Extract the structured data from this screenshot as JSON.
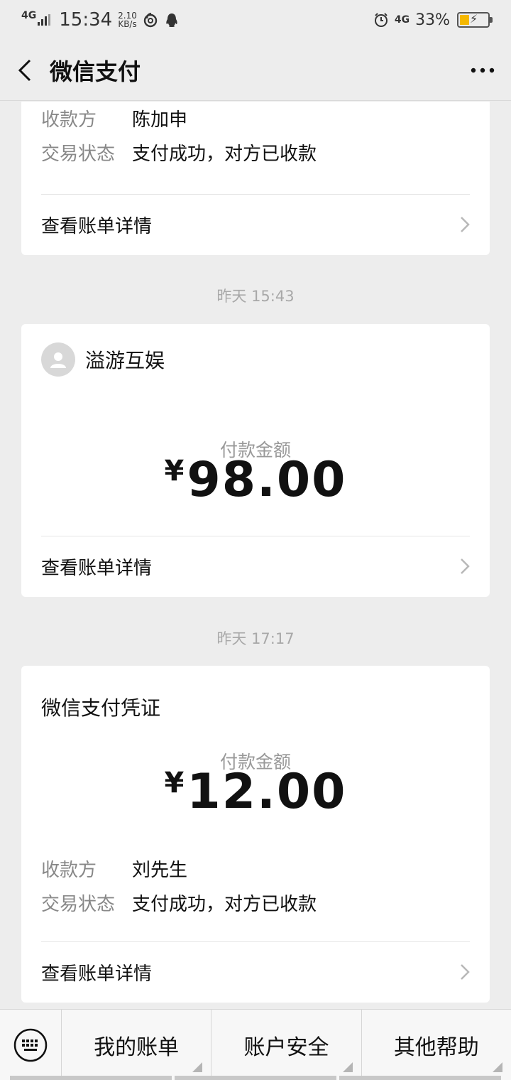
{
  "status_bar": {
    "network": "4G",
    "time": "15:34",
    "net_speed_value": "2.10",
    "net_speed_unit": "KB/s",
    "network_right": "4G",
    "battery_percent": "33%",
    "battery_level": 0.33
  },
  "nav": {
    "title": "微信支付"
  },
  "cards": [
    {
      "payee_label": "收款方",
      "payee_value": "陈加申",
      "status_label": "交易状态",
      "status_value": "支付成功，对方已收款",
      "detail_link": "查看账单详情"
    },
    {
      "timestamp": "昨天 15:43",
      "merchant_name": "溢游互娱",
      "amount_label": "付款金额",
      "currency": "¥",
      "amount": "98.00",
      "detail_link": "查看账单详情"
    },
    {
      "timestamp": "昨天 17:17",
      "title": "微信支付凭证",
      "amount_label": "付款金额",
      "currency": "¥",
      "amount": "12.00",
      "payee_label": "收款方",
      "payee_value": "刘先生",
      "status_label": "交易状态",
      "status_value": "支付成功，对方已收款",
      "detail_link": "查看账单详情"
    }
  ],
  "bottom_menu": {
    "items": [
      "我的账单",
      "账户安全",
      "其他帮助"
    ]
  },
  "icons": {
    "back": "chevron-left-icon",
    "more": "more-dots-icon",
    "keyboard": "keyboard-icon",
    "chevron": "chevron-right-icon",
    "avatar": "user-avatar-icon"
  },
  "colors": {
    "background": "#ededed",
    "card": "#ffffff",
    "battery": "#f5b800"
  }
}
